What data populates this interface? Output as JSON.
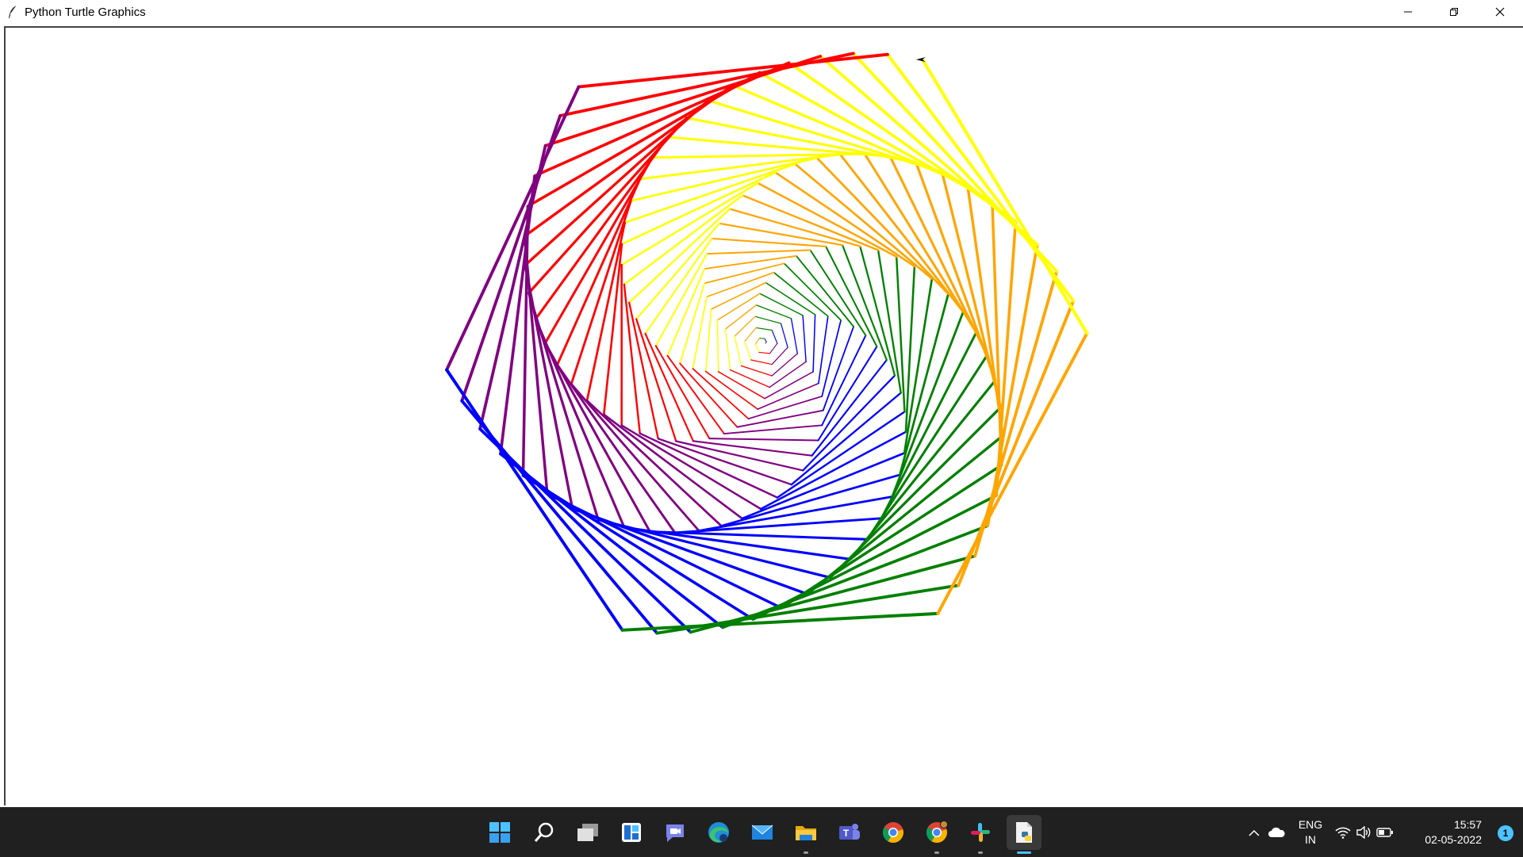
{
  "window": {
    "title": "Python Turtle Graphics"
  },
  "drawing": {
    "colors": [
      "#ff0000",
      "#800080",
      "#0000ff",
      "#008000",
      "#ffa500",
      "#ffff00"
    ],
    "shape": "spiral of hexagons",
    "cursor": "turtle-arrow"
  },
  "taskbar": {
    "apps": [
      {
        "name": "start-button",
        "icon": "windows-logo"
      },
      {
        "name": "search-button",
        "icon": "search-icon"
      },
      {
        "name": "task-view-button",
        "icon": "task-view-icon"
      },
      {
        "name": "widgets-button",
        "icon": "widgets-icon"
      },
      {
        "name": "chat-button",
        "icon": "chat-icon"
      },
      {
        "name": "edge-button",
        "icon": "edge-icon"
      },
      {
        "name": "mail-button",
        "icon": "mail-icon"
      },
      {
        "name": "file-explorer-button",
        "icon": "folder-icon"
      },
      {
        "name": "teams-button",
        "icon": "teams-icon"
      },
      {
        "name": "chrome-button",
        "icon": "chrome-icon"
      },
      {
        "name": "chrome-profile-button",
        "icon": "chrome-icon"
      },
      {
        "name": "slack-button",
        "icon": "slack-icon"
      },
      {
        "name": "python-button",
        "icon": "python-icon"
      }
    ],
    "language_line1": "ENG",
    "language_line2": "IN",
    "time": "15:57",
    "date": "02-05-2022",
    "notification_count": "1"
  }
}
